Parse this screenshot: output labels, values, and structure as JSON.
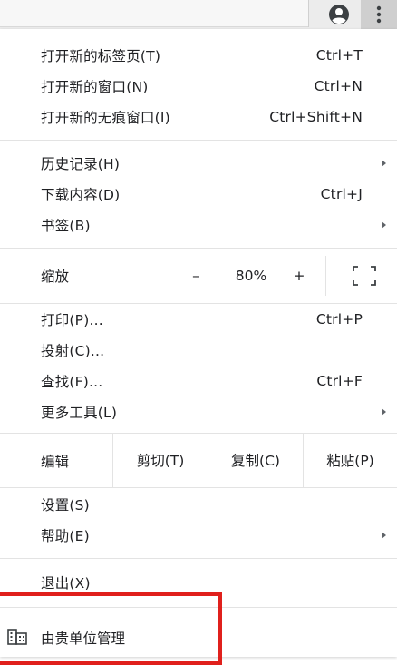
{
  "toolbar": {
    "avatar_icon": "account-circle-icon",
    "menu_icon": "more-vertical-icon"
  },
  "menu": {
    "group1": [
      {
        "label": "打开新的标签页(T)",
        "shortcut": "Ctrl+T"
      },
      {
        "label": "打开新的窗口(N)",
        "shortcut": "Ctrl+N"
      },
      {
        "label": "打开新的无痕窗口(I)",
        "shortcut": "Ctrl+Shift+N"
      }
    ],
    "group2": [
      {
        "label": "历史记录(H)",
        "shortcut": ""
      },
      {
        "label": "下载内容(D)",
        "shortcut": "Ctrl+J"
      },
      {
        "label": "书签(B)",
        "shortcut": ""
      }
    ],
    "zoom": {
      "label": "缩放",
      "minus": "–",
      "value": "80%",
      "plus": "+",
      "fullscreen_icon": "fullscreen-icon"
    },
    "group3": [
      {
        "label": "打印(P)...",
        "shortcut": "Ctrl+P"
      },
      {
        "label": "投射(C)...",
        "shortcut": ""
      },
      {
        "label": "查找(F)...",
        "shortcut": "Ctrl+F"
      },
      {
        "label": "更多工具(L)",
        "shortcut": ""
      }
    ],
    "edit": {
      "label": "编辑",
      "cut": "剪切(T)",
      "copy": "复制(C)",
      "paste": "粘贴(P)"
    },
    "group4": [
      {
        "label": "设置(S)",
        "shortcut": ""
      },
      {
        "label": "帮助(E)",
        "shortcut": ""
      }
    ],
    "exit": {
      "label": "退出(X)"
    },
    "managed": {
      "label": "由贵单位管理",
      "icon": "building-icon"
    }
  },
  "colors": {
    "highlight_box": "#e0201c",
    "text": "#202124",
    "separator": "#e3e3e3"
  }
}
